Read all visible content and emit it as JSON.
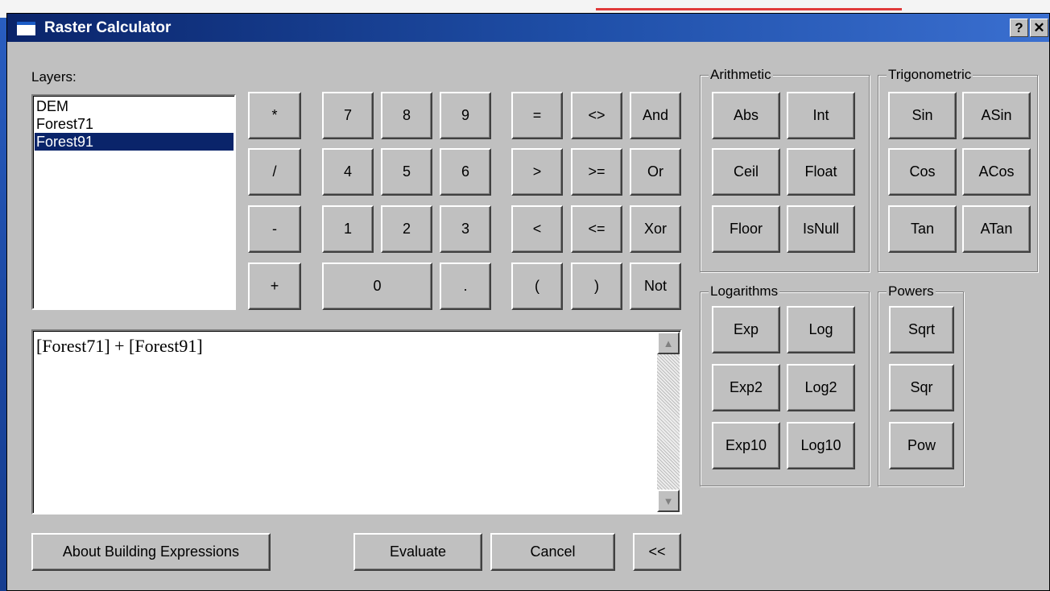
{
  "window": {
    "title": "Raster Calculator",
    "help_label": "?",
    "close_label": "✕"
  },
  "layers": {
    "label": "Layers:",
    "items": [
      {
        "name": "DEM"
      },
      {
        "name": "Forest71"
      },
      {
        "name": "Forest91",
        "selected": true
      }
    ]
  },
  "keypad": {
    "ops": [
      "*",
      "/",
      "-",
      "+"
    ],
    "digits": [
      "7",
      "8",
      "9",
      "4",
      "5",
      "6",
      "1",
      "2",
      "3",
      "0",
      "."
    ],
    "comparison": [
      "=",
      "<>",
      "And",
      ">",
      ">=",
      "Or",
      "<",
      "<=",
      "Xor",
      "(",
      ")",
      "Not"
    ]
  },
  "arithmetic": {
    "title": "Arithmetic",
    "buttons": [
      "Abs",
      "Int",
      "Ceil",
      "Float",
      "Floor",
      "IsNull"
    ]
  },
  "trigonometric": {
    "title": "Trigonometric",
    "buttons": [
      "Sin",
      "ASin",
      "Cos",
      "ACos",
      "Tan",
      "ATan"
    ]
  },
  "logarithms": {
    "title": "Logarithms",
    "buttons": [
      "Exp",
      "Log",
      "Exp2",
      "Log2",
      "Exp10",
      "Log10"
    ]
  },
  "powers": {
    "title": "Powers",
    "buttons": [
      "Sqrt",
      "Sqr",
      "Pow"
    ]
  },
  "expression": {
    "text": "[Forest71] + [Forest91]"
  },
  "footer": {
    "about_label": "About Building Expressions",
    "evaluate_label": "Evaluate",
    "cancel_label": "Cancel",
    "collapse_label": "<<"
  },
  "colors": {
    "title_bar": "#0a246a",
    "dialog_face": "#c0c0c0",
    "selection": "#0a246a"
  }
}
